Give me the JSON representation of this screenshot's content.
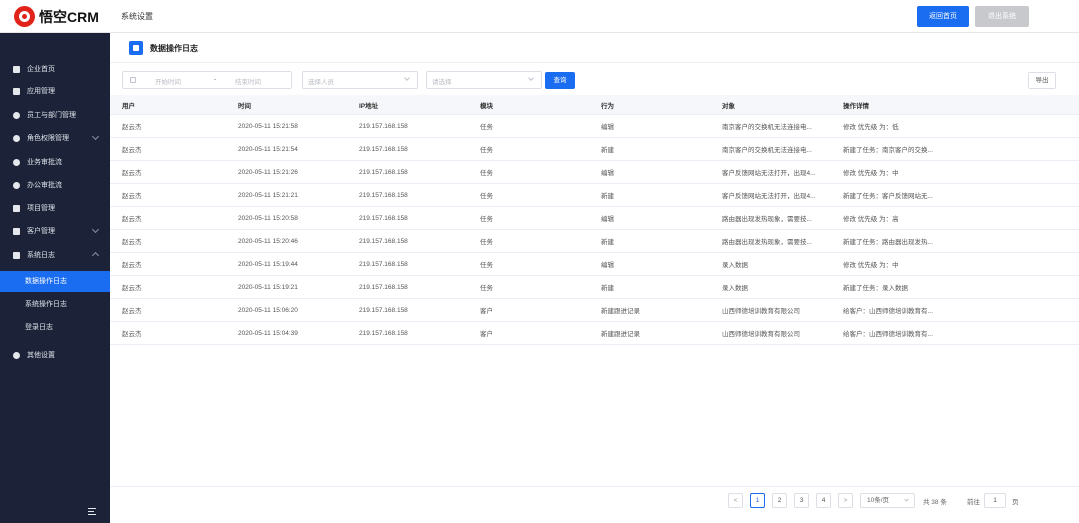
{
  "header": {
    "logo_text": "悟空CRM",
    "nav_title": "系统设置",
    "home_button": "返回首页",
    "logout_button": "退出系统"
  },
  "sidebar": {
    "items": [
      {
        "label": "企业首页",
        "icon": "home-icon"
      },
      {
        "label": "应用管理",
        "icon": "apps-icon"
      },
      {
        "label": "员工与部门管理",
        "icon": "users-icon"
      },
      {
        "label": "角色权限管理",
        "icon": "role-icon"
      },
      {
        "label": "业务审批流",
        "icon": "approval-icon"
      },
      {
        "label": "办公审批流",
        "icon": "office-approval-icon"
      },
      {
        "label": "项目管理",
        "icon": "project-icon"
      },
      {
        "label": "客户管理",
        "icon": "customer-icon"
      },
      {
        "label": "系统日志",
        "icon": "log-icon"
      },
      {
        "label": "其他设置",
        "icon": "gear-icon"
      }
    ],
    "sub_items": [
      "数据操作日志",
      "系统操作日志",
      "登录日志"
    ]
  },
  "page": {
    "title": "数据操作日志"
  },
  "filters": {
    "start_placeholder": "开始时间",
    "separator": "-",
    "end_placeholder": "结束时间",
    "user_placeholder": "选择人员",
    "module_placeholder": "请选择",
    "query_button": "查询",
    "export_button": "导出"
  },
  "table": {
    "columns": [
      "用户",
      "时间",
      "IP地址",
      "模块",
      "行为",
      "对象",
      "操作详情"
    ],
    "rows": [
      [
        "赵云杰",
        "2020-05-11 15:21:58",
        "219.157.168.158",
        "任务",
        "编辑",
        "南京客户的交换机无法连接电...",
        "修改 优先级 为：低"
      ],
      [
        "赵云杰",
        "2020-05-11 15:21:54",
        "219.157.168.158",
        "任务",
        "新建",
        "南京客户的交换机无法连接电...",
        "新建了任务：南京客户的交换..."
      ],
      [
        "赵云杰",
        "2020-05-11 15:21:26",
        "219.157.168.158",
        "任务",
        "编辑",
        "客户反馈网站无法打开，出现4...",
        "修改 优先级 为：中"
      ],
      [
        "赵云杰",
        "2020-05-11 15:21:21",
        "219.157.168.158",
        "任务",
        "新建",
        "客户反馈网站无法打开，出现4...",
        "新建了任务：客户反馈网站无..."
      ],
      [
        "赵云杰",
        "2020-05-11 15:20:58",
        "219.157.168.158",
        "任务",
        "编辑",
        "路由器出现发热现象，需要技...",
        "修改 优先级 为：高"
      ],
      [
        "赵云杰",
        "2020-05-11 15:20:46",
        "219.157.168.158",
        "任务",
        "新建",
        "路由器出现发热现象，需要技...",
        "新建了任务：路由器出现发热..."
      ],
      [
        "赵云杰",
        "2020-05-11 15:19:44",
        "219.157.168.158",
        "任务",
        "编辑",
        "录入数据",
        "修改 优先级 为：中"
      ],
      [
        "赵云杰",
        "2020-05-11 15:19:21",
        "219.157.168.158",
        "任务",
        "新建",
        "录入数据",
        "新建了任务：录入数据"
      ],
      [
        "赵云杰",
        "2020-05-11 15:06:20",
        "219.157.168.158",
        "客户",
        "新建跟进记录",
        "山西师德培训教育有限公司",
        "给客户：山西师德培训教育有..."
      ],
      [
        "赵云杰",
        "2020-05-11 15:04:39",
        "219.157.168.158",
        "客户",
        "新建跟进记录",
        "山西师德培训教育有限公司",
        "给客户：山西师德培训教育有..."
      ]
    ]
  },
  "pagination": {
    "prev": "<",
    "pages": [
      "1",
      "2",
      "3",
      "4"
    ],
    "next": ">",
    "page_size": "10条/页",
    "total": "共 38 条",
    "goto_label": "前往",
    "goto_value": "1",
    "goto_unit": "页"
  },
  "colors": {
    "primary": "#1a6cf0",
    "sidebar_bg": "#1c2338",
    "logo_red": "#e2231a"
  }
}
